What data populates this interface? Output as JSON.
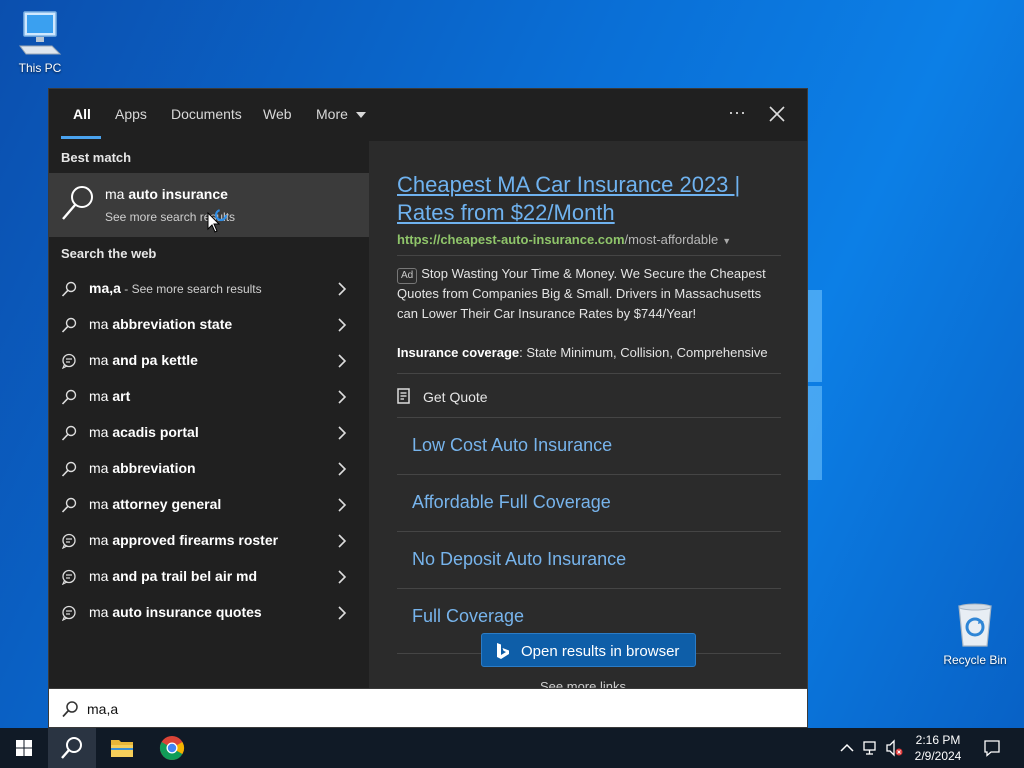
{
  "desktop": {
    "icons": [
      {
        "label": "This PC"
      },
      {
        "label": "Recycle Bin"
      }
    ]
  },
  "search_panel": {
    "tabs": [
      {
        "label": "All",
        "active": true
      },
      {
        "label": "Apps"
      },
      {
        "label": "Documents"
      },
      {
        "label": "Web"
      },
      {
        "label": "More"
      }
    ],
    "best_match": {
      "heading": "Best match",
      "title_prefix": "ma ",
      "title_bold": "auto insurance",
      "subtitle": "See more search results"
    },
    "web": {
      "heading": "Search the web",
      "first_item": {
        "bold": "ma,a",
        "muted": " - See more search results",
        "icon": "search-icon"
      },
      "items": [
        {
          "prefix": "ma ",
          "bold": "abbreviation state",
          "icon": "search-icon"
        },
        {
          "prefix": "ma ",
          "bold": "and pa kettle",
          "icon": "chat-icon"
        },
        {
          "prefix": "ma ",
          "bold": "art",
          "icon": "search-icon"
        },
        {
          "prefix": "ma ",
          "bold": "acadis portal",
          "icon": "search-icon"
        },
        {
          "prefix": "ma ",
          "bold": "abbreviation",
          "icon": "search-icon"
        },
        {
          "prefix": "ma ",
          "bold": "attorney general",
          "icon": "search-icon"
        },
        {
          "prefix": "ma ",
          "bold": "approved firearms roster",
          "icon": "chat-icon"
        },
        {
          "prefix": "ma ",
          "bold": "and pa trail bel air md",
          "icon": "chat-icon"
        },
        {
          "prefix": "ma ",
          "bold": "auto insurance quotes",
          "icon": "chat-icon"
        }
      ]
    },
    "preview": {
      "title": "Cheapest MA Car Insurance 2023 | Rates from $22/Month",
      "url_domain": "https://cheapest-auto-insurance.com",
      "url_path": "/most-affordable",
      "ad_badge": "Ad",
      "description": "Stop Wasting Your Time & Money. We Secure the Cheapest Quotes from Companies Big & Small. Drivers in Massachusetts can Lower Their Car Insurance Rates by $744/Year!",
      "coverage_label": "Insurance coverage",
      "coverage_value": ": State Minimum, Collision, Comprehensive",
      "get_quote": "Get Quote",
      "sublinks": [
        "Low Cost Auto Insurance",
        "Affordable Full Coverage",
        "No Deposit Auto Insurance",
        "Full Coverage"
      ],
      "open_in_browser": "Open results in browser",
      "see_more_links": "See more links"
    }
  },
  "search_box": {
    "value": "ma,a"
  },
  "taskbar": {
    "time": "2:16 PM",
    "date": "2/9/2024"
  },
  "colors": {
    "accent": "#4aa3ef",
    "link": "#6fb2ef",
    "url_green": "#8fc56a"
  }
}
